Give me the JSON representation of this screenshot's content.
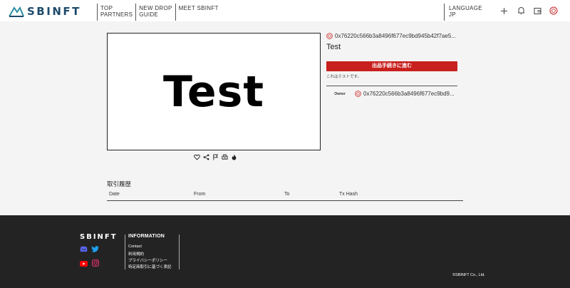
{
  "header": {
    "logo_text": "SBINFT",
    "nav": [
      {
        "line1": "TOP",
        "line2": "PARTNERS"
      },
      {
        "line1": "NEW DROP",
        "line2": "GUIDE"
      },
      {
        "line1": "MEET SBINFT",
        "line2": ""
      }
    ],
    "language": {
      "label": "LANGUAGE",
      "value": "JP"
    },
    "icons": [
      "plus-icon",
      "bell-icon",
      "wallet-icon",
      "avatar-icon"
    ]
  },
  "artwork": {
    "text": "Test"
  },
  "actions": [
    "heart-icon",
    "share-icon",
    "flag-icon",
    "print-icon",
    "fire-icon"
  ],
  "item": {
    "contract_address": "0x76220c566b3a8496f677ec9bd945b42f7ae5...",
    "title": "Test",
    "buy_button": "出品手続きに進む",
    "description": "これはテストです。",
    "owner_label": "Owner",
    "owner_address": "0x76220c566b3a8496f677ec9bd9..."
  },
  "history": {
    "title": "取引履歴",
    "columns": [
      "Date",
      "From",
      "To",
      "Tx Hash"
    ]
  },
  "footer": {
    "logo_text": "SBINFT",
    "social": [
      "discord-icon",
      "twitter-icon",
      "youtube-icon",
      "instagram-icon"
    ],
    "info_title": "INFORMATION",
    "links": [
      "Contact",
      "利用規約",
      "プライバシーポリシー",
      "特定商取引に基づく表記"
    ],
    "copyright": "©SBINFT Co., Ltd."
  },
  "colors": {
    "brand": "#1d4a6b",
    "accent_red": "#c8201e",
    "footer_bg": "#232323",
    "page_bg": "#f4f4f4"
  }
}
